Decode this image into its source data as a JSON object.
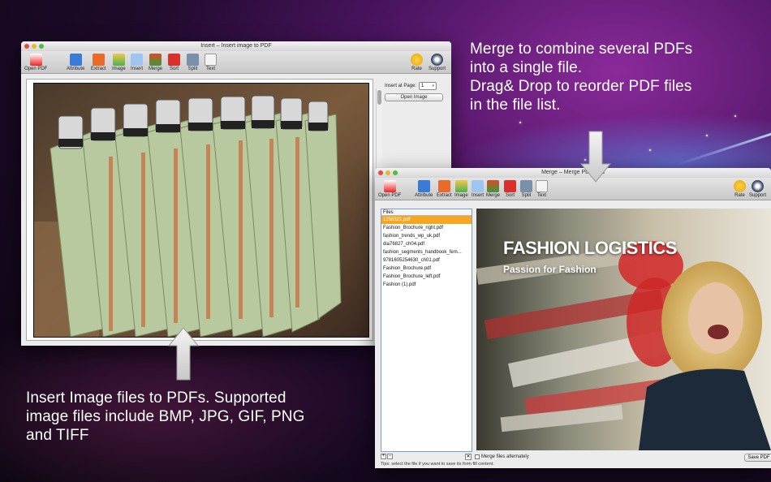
{
  "captions": {
    "merge": [
      "Merge to combine several PDFs",
      "into a single file.",
      "Drag& Drop to reorder PDF files",
      "in the file list."
    ],
    "insert": [
      "Insert Image files to PDFs. Supported",
      "image files include BMP, JPG, GIF, PNG",
      "and TIFF"
    ]
  },
  "insert_window": {
    "title": "Insert – Insert image to PDF",
    "toolbar": [
      "Open PDF",
      "Attribute",
      "Extract",
      "Image",
      "Insert",
      "Merge",
      "Sort",
      "Split",
      "Text"
    ],
    "toolbar_right": [
      "Rate",
      "Support"
    ],
    "insert_at_label": "Insert at Page:",
    "page_value": "1",
    "open_image": "Open Image"
  },
  "merge_window": {
    "title": "Merge – Merge PDF files",
    "toolbar": [
      "Open PDF",
      "Attribute",
      "Extract",
      "Image",
      "Insert",
      "Merge",
      "Sort",
      "Split",
      "Text"
    ],
    "toolbar_right": [
      "Rate",
      "Support"
    ],
    "files_header": "Files",
    "files": [
      "1256321.pdf",
      "Fashion_Brochure_right.pdf",
      "fashion_trends_wp_uk.pdf",
      "dia76827_ch04.pdf",
      "fashion_segments_handbook_fem...",
      "9781605254630_ch01.pdf",
      "Fashion_Brochure.pdf",
      "Fashion_Brochure_left.pdf",
      "Fashion (1).pdf"
    ],
    "selected_index": 0,
    "merge_alternately": "Merge files alternately",
    "tips": "Tips: select the file if you want to save its form fill content.",
    "save_pdf": "Save PDF",
    "preview_title": "FASHION LOGISTICS",
    "preview_subtitle": "Passion for Fashion"
  },
  "colors": {
    "selected_row": "#f5a623",
    "accent_blue": "#3b7bd8"
  }
}
